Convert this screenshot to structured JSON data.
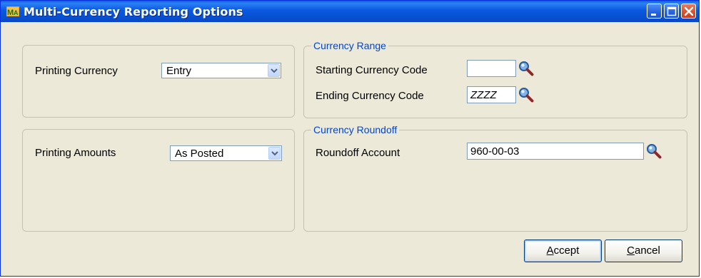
{
  "window": {
    "title": "Multi-Currency Reporting Options"
  },
  "printing_currency": {
    "label": "Printing Currency",
    "value": "Entry"
  },
  "printing_amounts": {
    "label": "Printing Amounts",
    "value": "As Posted"
  },
  "currency_range": {
    "legend": "Currency Range",
    "starting_label": "Starting Currency Code",
    "starting_value": "",
    "ending_label": "Ending Currency Code",
    "ending_value": "ZZZZ"
  },
  "currency_roundoff": {
    "legend": "Currency Roundoff",
    "account_label": "Roundoff Account",
    "account_value": "960-00-03"
  },
  "buttons": {
    "accept_prefix": "",
    "accept_mnemonic": "A",
    "accept_rest": "ccept",
    "cancel_prefix": "",
    "cancel_mnemonic": "C",
    "cancel_rest": "ancel"
  },
  "icons": {
    "app": "app-icon",
    "lookup": "magnifier-icon",
    "dropdown": "chevron-down-icon"
  },
  "colors": {
    "titlebar": "#0a5fd8",
    "legend": "#0046d5",
    "face": "#ece9d8"
  }
}
